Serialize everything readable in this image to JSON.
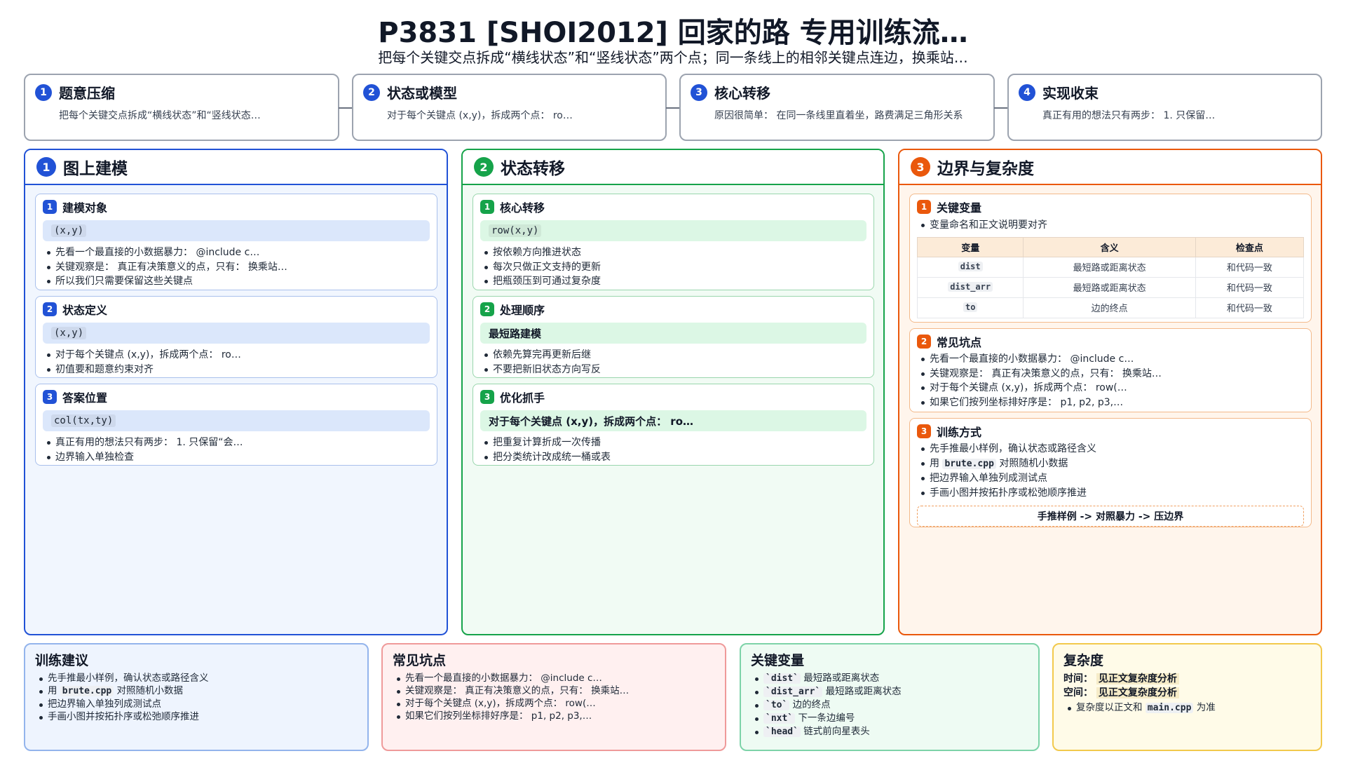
{
  "title": "P3831 [SHOI2012] 回家的路 专用训练流…",
  "subtitle": "把每个关键交点拆成“横线状态”和“竖线状态”两个点；同一条线上的相邻关键点连边，换乘站…",
  "colors": {
    "blue": "#2152d6",
    "green": "#16a34a",
    "orange": "#ea580c"
  },
  "steps": [
    {
      "num": "1",
      "title": "题意压缩",
      "desc": "把每个关键交点拆成“横线状态”和“竖线状态…"
    },
    {
      "num": "2",
      "title": "状态或模型",
      "desc": "对于每个关键点 (x,y)，拆成两个点： ro…"
    },
    {
      "num": "3",
      "title": "核心转移",
      "desc": "原因很简单： 在同一条线里直着坐，路费满足三角形关系"
    },
    {
      "num": "4",
      "title": "实现收束",
      "desc": "真正有用的想法只有两步： 1. 只保留…"
    }
  ],
  "col1": {
    "num": "1",
    "title": "图上建模",
    "cards": [
      {
        "num": "1",
        "title": "建模对象",
        "pill": "(x,y)",
        "items": [
          "先看一个最直接的小数据暴力： @include c…",
          "关键观察是： 真正有决策意义的点，只有： 换乘站…",
          "所以我们只需要保留这些关键点"
        ]
      },
      {
        "num": "2",
        "title": "状态定义",
        "pill": "(x,y)",
        "items": [
          "对于每个关键点 (x,y)，拆成两个点： ro…",
          "初值要和题意约束对齐"
        ]
      },
      {
        "num": "3",
        "title": "答案位置",
        "pill": "col(tx,ty)",
        "items": [
          "真正有用的想法只有两步： 1. 只保留“会…",
          "边界输入单独检查"
        ]
      }
    ]
  },
  "col2": {
    "num": "2",
    "title": "状态转移",
    "cards": [
      {
        "num": "1",
        "title": "核心转移",
        "pill": "row(x,y)",
        "items": [
          "按依赖方向推进状态",
          "每次只做正文支持的更新",
          "把瓶颈压到可通过复杂度"
        ]
      },
      {
        "num": "2",
        "title": "处理顺序",
        "pill": "最短路建模",
        "items": [
          "依赖先算完再更新后继",
          "不要把新旧状态方向写反"
        ]
      },
      {
        "num": "3",
        "title": "优化抓手",
        "pill": "对于每个关键点 (x,y)，拆成两个点： ro…",
        "items": [
          "把重复计算折成一次传播",
          "把分类统计改成统一桶或表"
        ]
      }
    ]
  },
  "col3": {
    "num": "3",
    "title": "边界与复杂度",
    "card1": {
      "num": "1",
      "title": "关键变量",
      "note": "变量命名和正文说明要对齐",
      "headers": [
        "变量",
        "含义",
        "检查点"
      ],
      "rows": [
        [
          "dist",
          "最短路或距离状态",
          "和代码一致"
        ],
        [
          "dist_arr",
          "最短路或距离状态",
          "和代码一致"
        ],
        [
          "to",
          "边的终点",
          "和代码一致"
        ]
      ]
    },
    "card2": {
      "num": "2",
      "title": "常见坑点",
      "items": [
        "先看一个最直接的小数据暴力： @include c…",
        "关键观察是： 真正有决策意义的点，只有： 换乘站…",
        "对于每个关键点 (x,y)，拆成两个点： row(…",
        "如果它们按列坐标排好序是： p1, p2, p3,…"
      ]
    },
    "card3": {
      "num": "3",
      "title": "训练方式",
      "items": [
        "先手推最小样例，确认状态或路径含义",
        "用 ",
        "把边界输入单独列成测试点",
        "手画小图并按拓扑序或松弛顺序推进"
      ],
      "brute": "brute.cpp",
      "brute_tail": " 对照随机小数据",
      "flow": "手推样例 -> 对照暴力 -> 压边界"
    }
  },
  "bottom": [
    {
      "title": "训练建议",
      "items": [
        "先手推最小样例，确认状态或路径含义",
        "用 brute.cpp 对照随机小数据",
        "把边界输入单独列成测试点",
        "手画小图并按拓扑序或松弛顺序推进"
      ]
    },
    {
      "title": "常见坑点",
      "items": [
        "先看一个最直接的小数据暴力： @include c…",
        "关键观察是： 真正有决策意义的点，只有： 换乘站…",
        "对于每个关键点 (x,y)，拆成两个点： row(…",
        "如果它们按列坐标排好序是： p1, p2, p3,…"
      ]
    },
    {
      "title": "关键变量",
      "vars": [
        [
          "`dist`",
          "最短路或距离状态"
        ],
        [
          "`dist_arr`",
          "最短路或距离状态"
        ],
        [
          "`to`",
          "边的终点"
        ],
        [
          "`nxt`",
          "下一条边编号"
        ],
        [
          "`head`",
          "链式前向星表头"
        ]
      ]
    },
    {
      "title": "复杂度",
      "time_label": "时间：",
      "time_value": "见正文复杂度分析",
      "space_label": "空间：",
      "space_value": "见正文复杂度分析",
      "note_pre": "复杂度以正文和 ",
      "note_code": "main.cpp",
      "note_post": " 为准"
    }
  ]
}
